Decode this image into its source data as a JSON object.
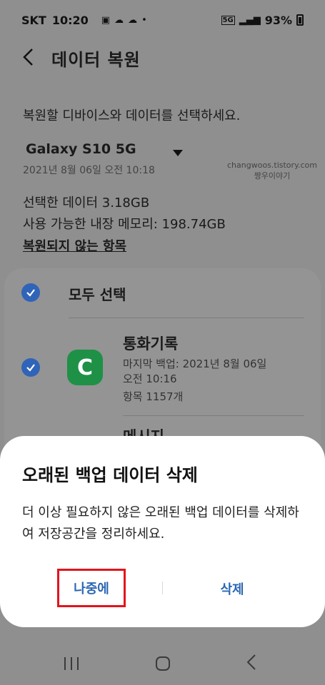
{
  "status_bar": {
    "carrier": "SKT",
    "time": "10:20",
    "battery": "93%",
    "network": "5G"
  },
  "header": {
    "title": "데이터 복원"
  },
  "content": {
    "instruction": "복원할 디바이스와 데이터를 선택하세요.",
    "device_name": "Galaxy S10 5G",
    "device_date": "2021년 8월 06일 오전 10:18",
    "watermark_line1": "changwoos.tistory.com",
    "watermark_line2": "짱우이야기",
    "selected_data": "선택한 데이터 3.18GB",
    "available_memory": "사용 가능한 내장 메모리: 198.74GB",
    "not_restored_link": "복원되지 않는 항목"
  },
  "list": {
    "select_all": "모두 선택",
    "items": [
      {
        "title": "통화기록",
        "backup_line1": "마지막 백업: 2021년 8월 06일",
        "backup_line2": "오전 10:16",
        "count": "항목 1157개"
      }
    ],
    "next_item_peek": "메시지"
  },
  "dialog": {
    "title": "오래된 백업 데이터 삭제",
    "message": "더 이상 필요하지 않은 오래된 백업 데이터를 삭제하여 저장공간을 정리하세요.",
    "later_button": "나중에",
    "delete_button": "삭제"
  },
  "colors": {
    "accent": "#2b67b2",
    "highlight_border": "#e3141c",
    "checkbox": "#2f64b8",
    "call_log_icon": "#1e9146"
  }
}
